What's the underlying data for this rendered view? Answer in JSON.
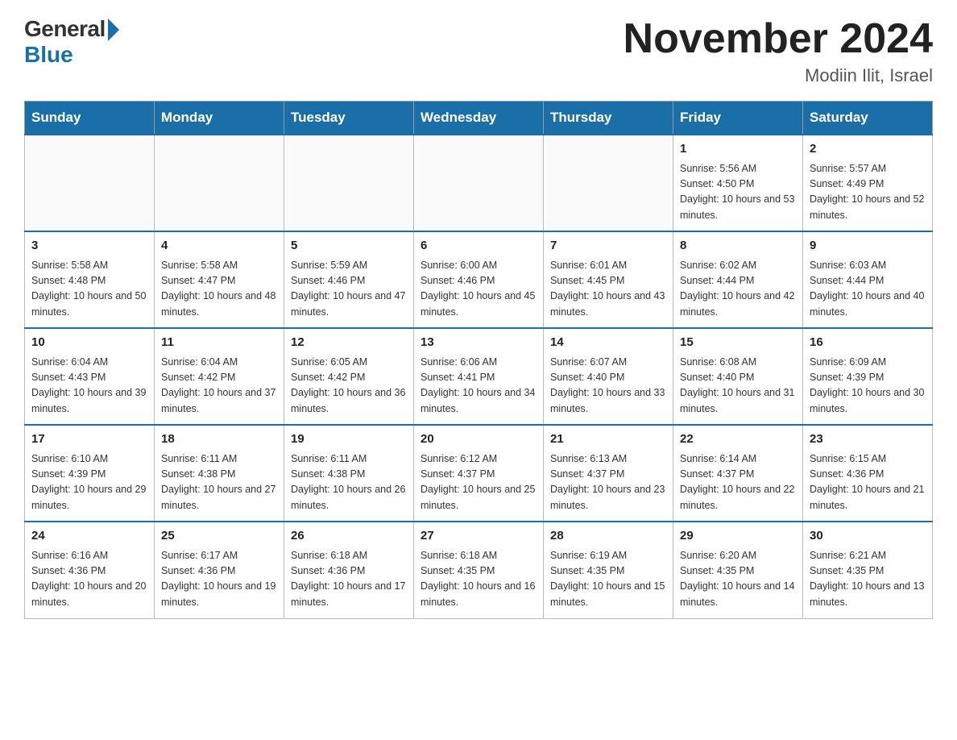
{
  "logo": {
    "general": "General",
    "blue": "Blue"
  },
  "header": {
    "title": "November 2024",
    "location": "Modiin Ilit, Israel"
  },
  "days_of_week": [
    "Sunday",
    "Monday",
    "Tuesday",
    "Wednesday",
    "Thursday",
    "Friday",
    "Saturday"
  ],
  "weeks": [
    [
      {
        "day": "",
        "info": ""
      },
      {
        "day": "",
        "info": ""
      },
      {
        "day": "",
        "info": ""
      },
      {
        "day": "",
        "info": ""
      },
      {
        "day": "",
        "info": ""
      },
      {
        "day": "1",
        "info": "Sunrise: 5:56 AM\nSunset: 4:50 PM\nDaylight: 10 hours and 53 minutes."
      },
      {
        "day": "2",
        "info": "Sunrise: 5:57 AM\nSunset: 4:49 PM\nDaylight: 10 hours and 52 minutes."
      }
    ],
    [
      {
        "day": "3",
        "info": "Sunrise: 5:58 AM\nSunset: 4:48 PM\nDaylight: 10 hours and 50 minutes."
      },
      {
        "day": "4",
        "info": "Sunrise: 5:58 AM\nSunset: 4:47 PM\nDaylight: 10 hours and 48 minutes."
      },
      {
        "day": "5",
        "info": "Sunrise: 5:59 AM\nSunset: 4:46 PM\nDaylight: 10 hours and 47 minutes."
      },
      {
        "day": "6",
        "info": "Sunrise: 6:00 AM\nSunset: 4:46 PM\nDaylight: 10 hours and 45 minutes."
      },
      {
        "day": "7",
        "info": "Sunrise: 6:01 AM\nSunset: 4:45 PM\nDaylight: 10 hours and 43 minutes."
      },
      {
        "day": "8",
        "info": "Sunrise: 6:02 AM\nSunset: 4:44 PM\nDaylight: 10 hours and 42 minutes."
      },
      {
        "day": "9",
        "info": "Sunrise: 6:03 AM\nSunset: 4:44 PM\nDaylight: 10 hours and 40 minutes."
      }
    ],
    [
      {
        "day": "10",
        "info": "Sunrise: 6:04 AM\nSunset: 4:43 PM\nDaylight: 10 hours and 39 minutes."
      },
      {
        "day": "11",
        "info": "Sunrise: 6:04 AM\nSunset: 4:42 PM\nDaylight: 10 hours and 37 minutes."
      },
      {
        "day": "12",
        "info": "Sunrise: 6:05 AM\nSunset: 4:42 PM\nDaylight: 10 hours and 36 minutes."
      },
      {
        "day": "13",
        "info": "Sunrise: 6:06 AM\nSunset: 4:41 PM\nDaylight: 10 hours and 34 minutes."
      },
      {
        "day": "14",
        "info": "Sunrise: 6:07 AM\nSunset: 4:40 PM\nDaylight: 10 hours and 33 minutes."
      },
      {
        "day": "15",
        "info": "Sunrise: 6:08 AM\nSunset: 4:40 PM\nDaylight: 10 hours and 31 minutes."
      },
      {
        "day": "16",
        "info": "Sunrise: 6:09 AM\nSunset: 4:39 PM\nDaylight: 10 hours and 30 minutes."
      }
    ],
    [
      {
        "day": "17",
        "info": "Sunrise: 6:10 AM\nSunset: 4:39 PM\nDaylight: 10 hours and 29 minutes."
      },
      {
        "day": "18",
        "info": "Sunrise: 6:11 AM\nSunset: 4:38 PM\nDaylight: 10 hours and 27 minutes."
      },
      {
        "day": "19",
        "info": "Sunrise: 6:11 AM\nSunset: 4:38 PM\nDaylight: 10 hours and 26 minutes."
      },
      {
        "day": "20",
        "info": "Sunrise: 6:12 AM\nSunset: 4:37 PM\nDaylight: 10 hours and 25 minutes."
      },
      {
        "day": "21",
        "info": "Sunrise: 6:13 AM\nSunset: 4:37 PM\nDaylight: 10 hours and 23 minutes."
      },
      {
        "day": "22",
        "info": "Sunrise: 6:14 AM\nSunset: 4:37 PM\nDaylight: 10 hours and 22 minutes."
      },
      {
        "day": "23",
        "info": "Sunrise: 6:15 AM\nSunset: 4:36 PM\nDaylight: 10 hours and 21 minutes."
      }
    ],
    [
      {
        "day": "24",
        "info": "Sunrise: 6:16 AM\nSunset: 4:36 PM\nDaylight: 10 hours and 20 minutes."
      },
      {
        "day": "25",
        "info": "Sunrise: 6:17 AM\nSunset: 4:36 PM\nDaylight: 10 hours and 19 minutes."
      },
      {
        "day": "26",
        "info": "Sunrise: 6:18 AM\nSunset: 4:36 PM\nDaylight: 10 hours and 17 minutes."
      },
      {
        "day": "27",
        "info": "Sunrise: 6:18 AM\nSunset: 4:35 PM\nDaylight: 10 hours and 16 minutes."
      },
      {
        "day": "28",
        "info": "Sunrise: 6:19 AM\nSunset: 4:35 PM\nDaylight: 10 hours and 15 minutes."
      },
      {
        "day": "29",
        "info": "Sunrise: 6:20 AM\nSunset: 4:35 PM\nDaylight: 10 hours and 14 minutes."
      },
      {
        "day": "30",
        "info": "Sunrise: 6:21 AM\nSunset: 4:35 PM\nDaylight: 10 hours and 13 minutes."
      }
    ]
  ]
}
